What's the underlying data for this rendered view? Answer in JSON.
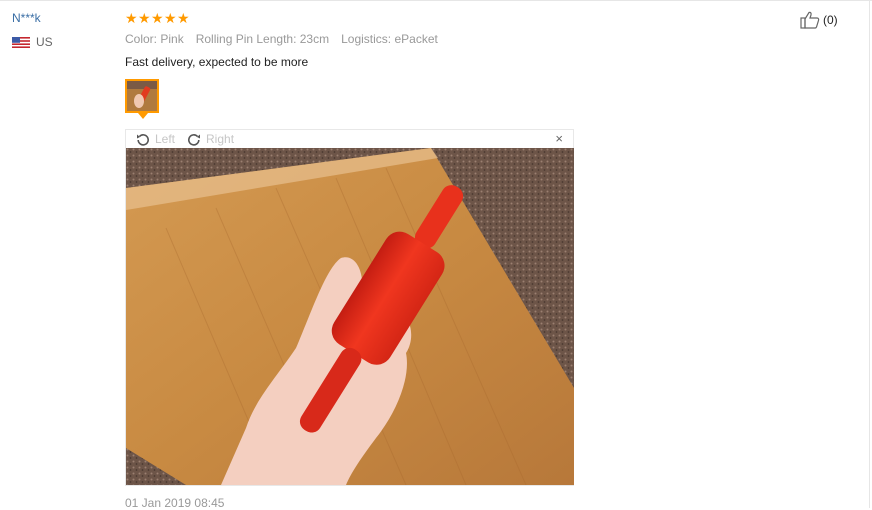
{
  "review": {
    "user_name": "N***k",
    "country": "US",
    "rating": 5,
    "color": "Color: Pink",
    "pin_length": "Rolling Pin Length: 23cm",
    "logistics": "Logistics: ePacket",
    "comment": "Fast delivery, expected to be more",
    "date": "01 Jan 2019 08:45",
    "likes": "(0)"
  },
  "viewer": {
    "rotate_left": "Left",
    "rotate_right": "Right",
    "close_symbol": "×"
  },
  "colors": {
    "accent": "#ff9a00",
    "link": "#3a6ea5",
    "muted": "#999999"
  },
  "icons": {
    "flag": "us-flag-icon",
    "stars": "star-icon",
    "rotate_left": "rotate-left-icon",
    "rotate_right": "rotate-right-icon",
    "close": "close-icon",
    "thumb_up": "thumbs-up-icon"
  }
}
